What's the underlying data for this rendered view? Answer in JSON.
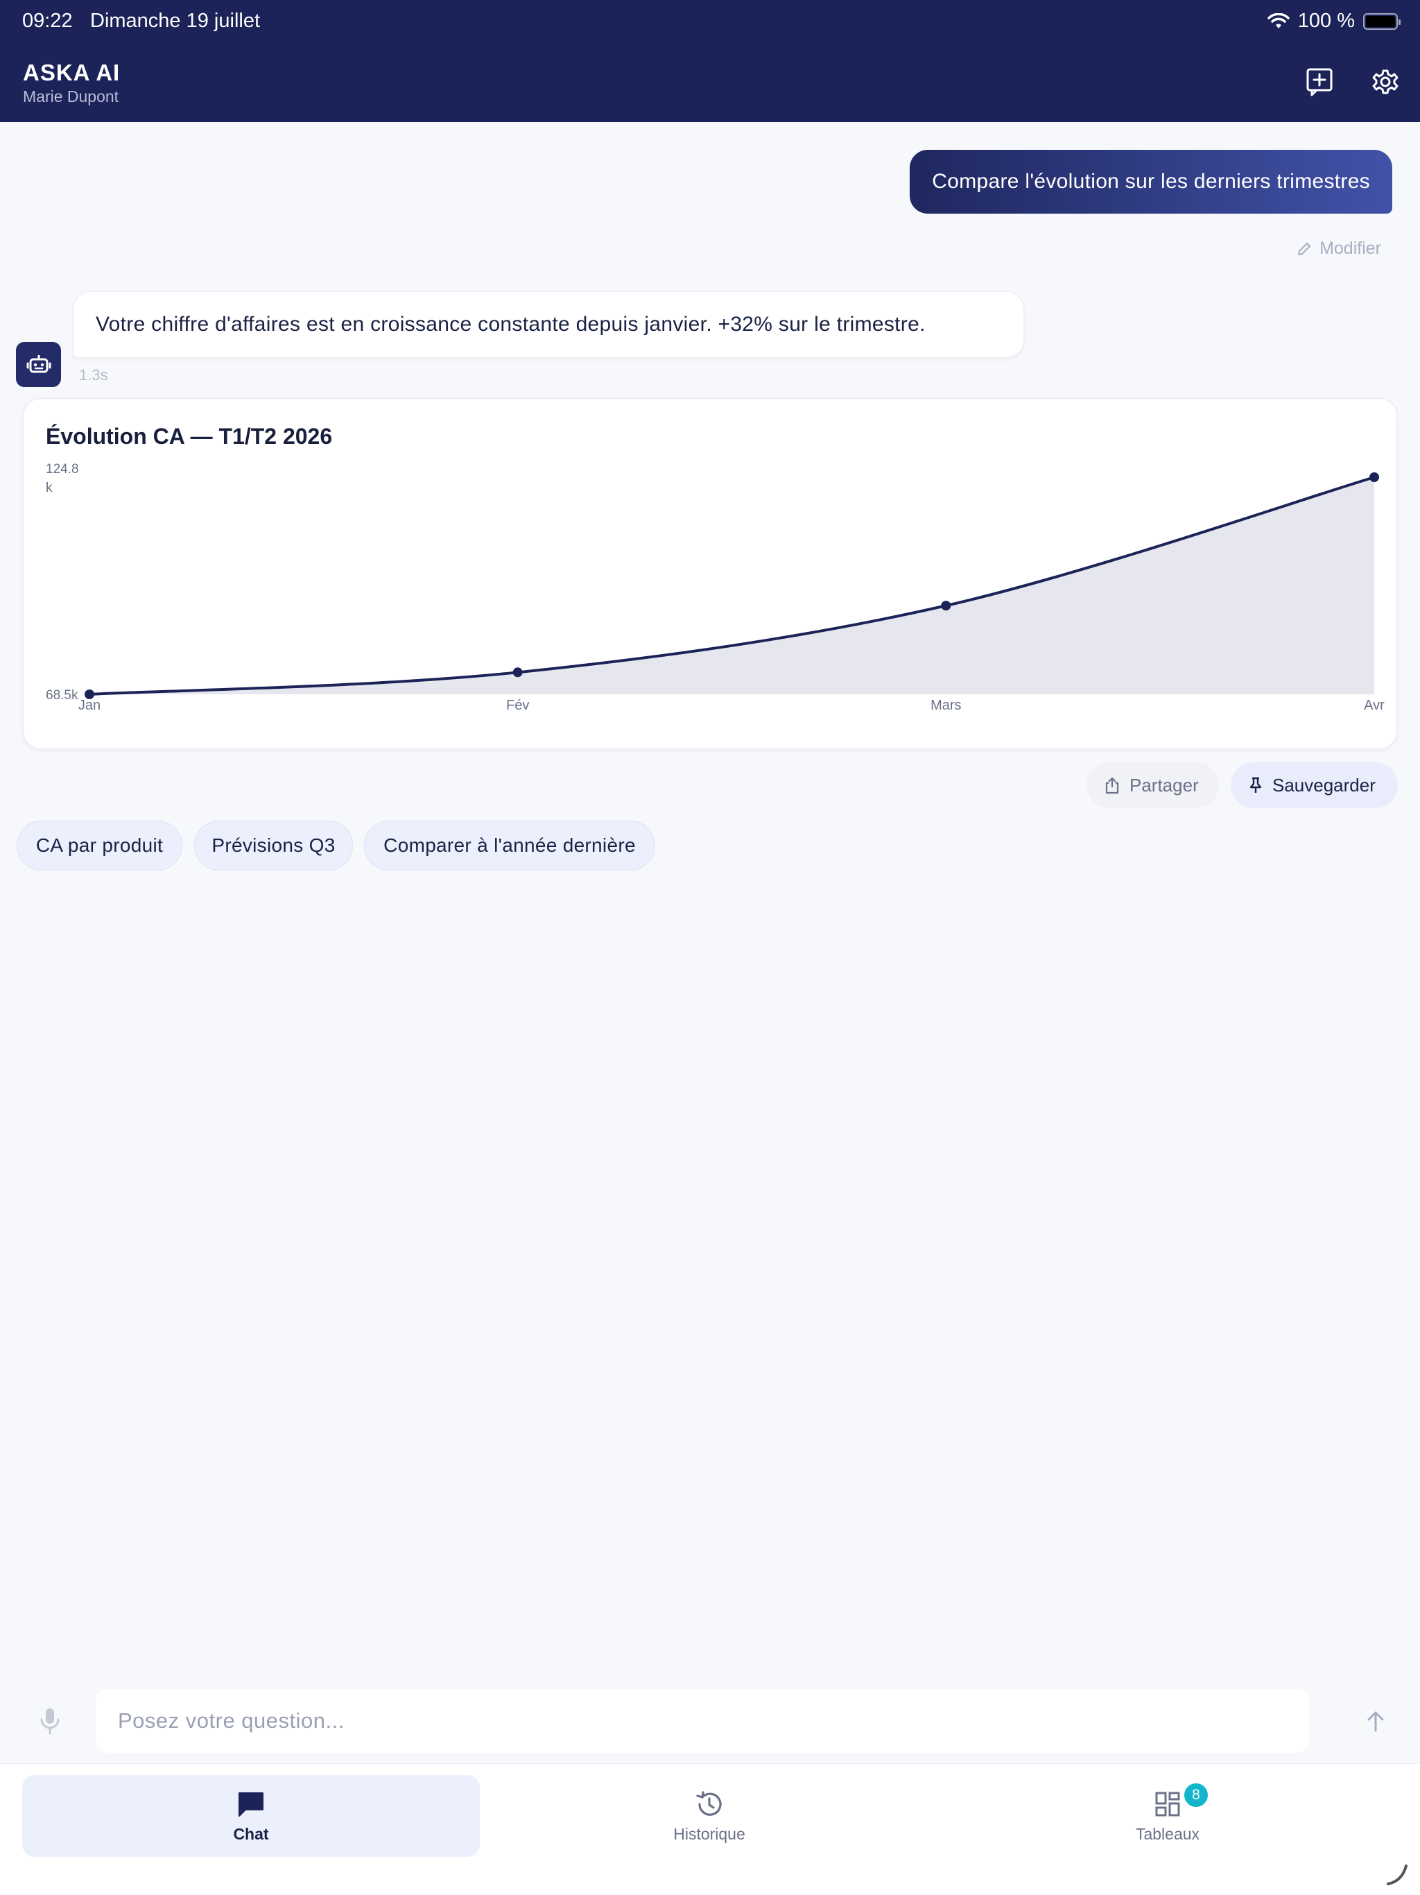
{
  "status_bar": {
    "time": "09:22",
    "date": "Dimanche 19 juillet",
    "battery": "100 %"
  },
  "header": {
    "title": "ASKA AI",
    "user": "Marie Dupont",
    "icons": [
      "new-chat-icon",
      "settings-icon"
    ]
  },
  "conversation": {
    "user_message": "Compare l'évolution sur les derniers trimestres",
    "modify_label": "Modifier",
    "ai_message": "Votre chiffre d'affaires est en croissance constante depuis janvier. +32% sur le trimestre.",
    "latency": "1.3s"
  },
  "chart_data": {
    "type": "area",
    "title": "Évolution CA — T1/T2 2026",
    "categories": [
      "Jan",
      "Fév",
      "Mars",
      "Avr"
    ],
    "values": [
      68.5,
      74.2,
      91.5,
      124.8
    ],
    "y_tick_labels": [
      "124.8\nk",
      "68.5k"
    ],
    "ylim": [
      68.5,
      124.8
    ],
    "xlabel": "",
    "ylabel": "",
    "grid": false,
    "line_color": "#1b2358",
    "fill_color": "#e6e7ee"
  },
  "actions": {
    "share": "Partager",
    "save": "Sauvegarder"
  },
  "suggestions": [
    "CA par produit",
    "Prévisions Q3",
    "Comparer à l'année dernière"
  ],
  "composer": {
    "placeholder": "Posez votre question..."
  },
  "tabs": [
    {
      "label": "Chat",
      "icon": "chat-icon",
      "active": true
    },
    {
      "label": "Historique",
      "icon": "history-icon",
      "active": false
    },
    {
      "label": "Tableaux",
      "icon": "dashboard-icon",
      "active": false,
      "badge": "8"
    }
  ]
}
